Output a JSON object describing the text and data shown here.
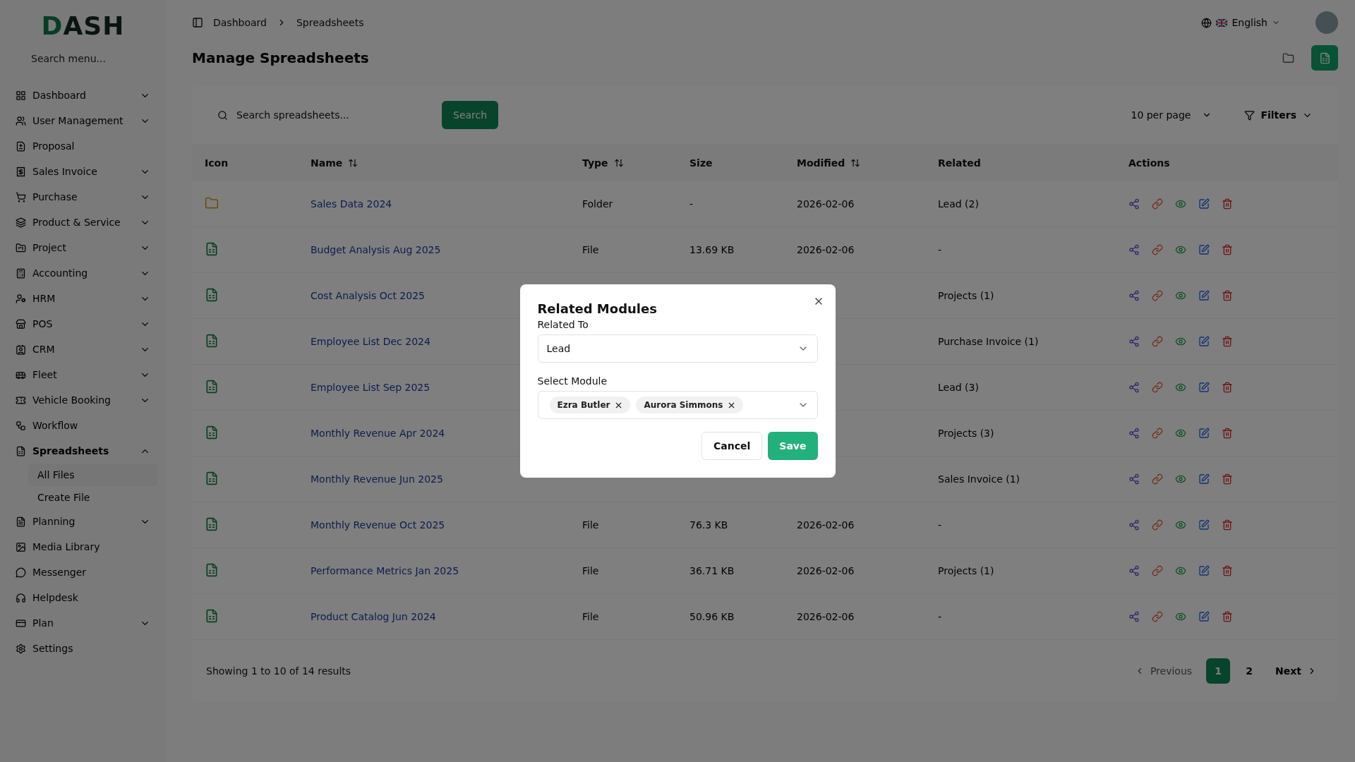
{
  "logo": "DASH",
  "sidebar": {
    "search_placeholder": "Search menu...",
    "items": [
      {
        "label": "Dashboard",
        "expanded": false,
        "selected": false
      },
      {
        "label": "User Management",
        "expanded": false,
        "selected": false
      },
      {
        "label": "Proposal",
        "selected": false
      },
      {
        "label": "Sales Invoice",
        "expanded": false,
        "selected": false
      },
      {
        "label": "Purchase",
        "expanded": false,
        "selected": false
      },
      {
        "label": "Product & Service",
        "expanded": false,
        "selected": false
      },
      {
        "label": "Project",
        "expanded": false,
        "selected": false
      },
      {
        "label": "Accounting",
        "expanded": false,
        "selected": false
      },
      {
        "label": "HRM",
        "expanded": false,
        "selected": false
      },
      {
        "label": "POS",
        "expanded": false,
        "selected": false
      },
      {
        "label": "CRM",
        "expanded": false,
        "selected": false
      },
      {
        "label": "Fleet",
        "expanded": false,
        "selected": false
      },
      {
        "label": "Vehicle Booking",
        "expanded": false,
        "selected": false
      },
      {
        "label": "Workflow",
        "selected": false
      },
      {
        "label": "Spreadsheets",
        "expanded": true,
        "selected": true,
        "children": [
          {
            "label": "All Files",
            "selected": true
          },
          {
            "label": "Create File",
            "selected": false
          }
        ]
      },
      {
        "label": "Planning",
        "expanded": false,
        "selected": false
      },
      {
        "label": "Media Library",
        "selected": false
      },
      {
        "label": "Messenger",
        "selected": false
      },
      {
        "label": "Helpdesk",
        "selected": false
      },
      {
        "label": "Plan",
        "expanded": false,
        "selected": false
      },
      {
        "label": "Settings",
        "selected": false
      }
    ]
  },
  "breadcrumb": [
    "Dashboard",
    "Spreadsheets"
  ],
  "language": "English",
  "page_title": "Manage Spreadsheets",
  "toolbar": {
    "search_placeholder": "Search spreadsheets...",
    "search_button": "Search",
    "per_page": "10 per page",
    "filters": "Filters"
  },
  "table": {
    "columns": [
      {
        "label": "Icon",
        "sortable": false
      },
      {
        "label": "Name",
        "sortable": true
      },
      {
        "label": "Type",
        "sortable": true
      },
      {
        "label": "Size",
        "sortable": false
      },
      {
        "label": "Modified",
        "sortable": true
      },
      {
        "label": "Related",
        "sortable": false
      },
      {
        "label": "Actions",
        "sortable": false
      }
    ],
    "rows": [
      {
        "kind": "folder",
        "name": "Sales Data 2024",
        "type": "Folder",
        "size": "-",
        "modified": "2026-02-06",
        "related": "Lead (2)"
      },
      {
        "kind": "file",
        "name": "Budget Analysis Aug 2025",
        "type": "File",
        "size": "13.69 KB",
        "modified": "2026-02-06",
        "related": "-"
      },
      {
        "kind": "file",
        "name": "Cost Analysis Oct 2025",
        "related": "Projects (1)"
      },
      {
        "kind": "file",
        "name": "Employee List Dec 2024",
        "related": "Purchase Invoice (1)"
      },
      {
        "kind": "file",
        "name": "Employee List Sep 2025",
        "related": "Lead (3)"
      },
      {
        "kind": "file",
        "name": "Monthly Revenue Apr 2024",
        "related": "Projects (3)"
      },
      {
        "kind": "file",
        "name": "Monthly Revenue Jun 2025",
        "related": "Sales Invoice (1)"
      },
      {
        "kind": "file",
        "name": "Monthly Revenue Oct 2025",
        "type": "File",
        "size": "76.3 KB",
        "modified": "2026-02-06",
        "related": "-"
      },
      {
        "kind": "file",
        "name": "Performance Metrics Jan 2025",
        "type": "File",
        "size": "36.71 KB",
        "modified": "2026-02-06",
        "related": "Projects (1)"
      },
      {
        "kind": "file",
        "name": "Product Catalog Jun 2024",
        "type": "File",
        "size": "50.96 KB",
        "modified": "2026-02-06",
        "related": "-"
      }
    ]
  },
  "footer": {
    "summary": "Showing 1 to 10 of 14 results",
    "previous": {
      "label": "Previous",
      "disabled": true
    },
    "pages": [
      {
        "label": "1",
        "selected": true
      },
      {
        "label": "2",
        "selected": false
      }
    ],
    "next": {
      "label": "Next",
      "disabled": false
    }
  },
  "dialog": {
    "title": "Related Modules",
    "related_label": "Related To",
    "related_value": "Lead",
    "module_label": "Select Module",
    "modules": [
      "Ezra Butler",
      "Aurora Simmons"
    ],
    "buttons": [
      {
        "kind": "secondary",
        "label": "Cancel"
      },
      {
        "kind": "primary",
        "label": "Save"
      }
    ]
  }
}
